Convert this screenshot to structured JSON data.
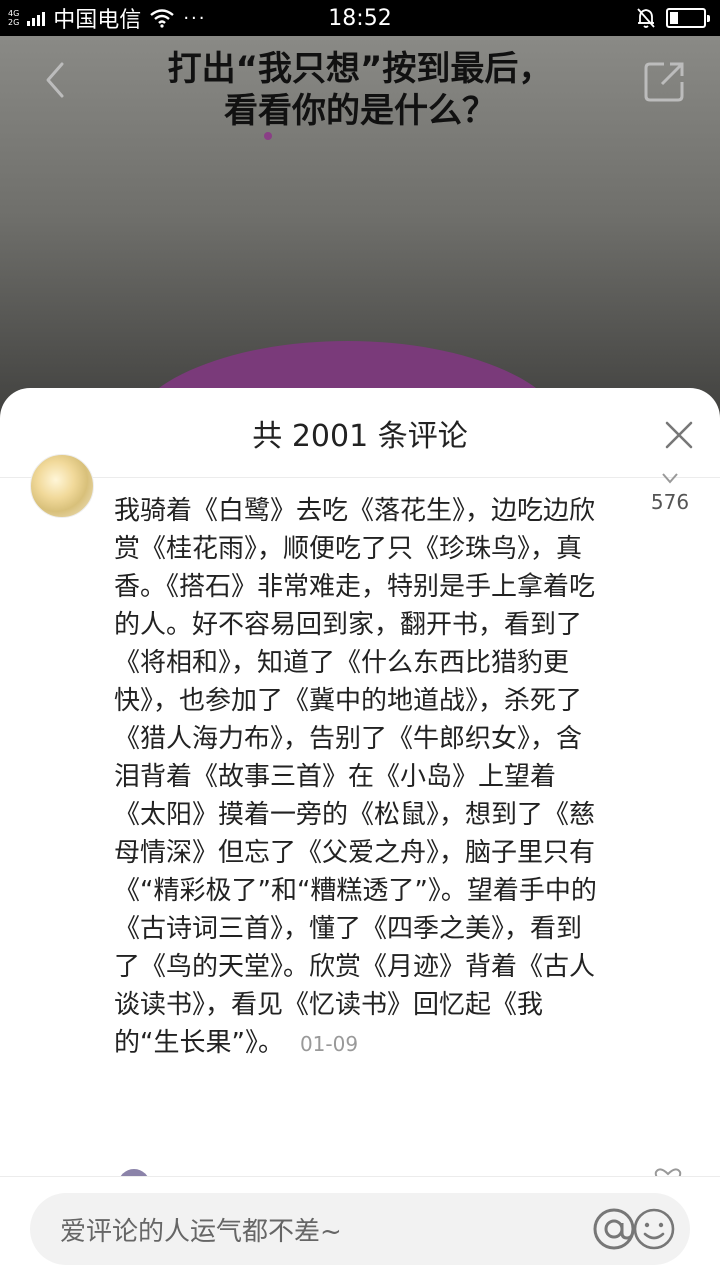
{
  "status_bar": {
    "network_top": "4G",
    "network_bottom": "2G",
    "carrier": "中国电信",
    "more": "···",
    "time": "18:52",
    "battery_level": 0.25
  },
  "video": {
    "title_line1": "打出“我只想”按到最后，",
    "title_line2": "看看你的是什么？",
    "back_icon": "back-arrow-icon",
    "share_icon": "share-icon",
    "accent_color": "#7a3a7a"
  },
  "comments_panel": {
    "title": "共 2001 条评论",
    "close_icon": "close-icon",
    "comment": {
      "like_count": "576",
      "text": "我骑着《白鹭》去吃《落花生》，边吃边欣赏《桂花雨》，顺便吃了只《珍珠鸟》，真香。《搭石》非常难走，特别是手上拿着吃的人。好不容易回到家，翻开书，看到了《将相和》，知道了《什么东西比猎豹更快》，也参加了《冀中的地道战》，杀死了《猎人海力布》，告别了《牛郎织女》，含泪背着《故事三首》在《小岛》上望着《太阳》摸着一旁的《松鼠》，想到了《慈母情深》但忘了《父爱之舟》，脑子里只有《“精彩极了”和“糟糕透了”》。望着手中的《古诗词三首》，懂了《四季之美》，看到了《鸟的天堂》。欣赏《月迹》背着《古人谈读书》，看见《忆读书》回忆起《我的“生长果”》。",
      "date": "01-09"
    }
  },
  "input": {
    "placeholder": "爱评论的人运气都不差~",
    "mention_icon": "at-icon",
    "emoji_icon": "emoji-icon"
  }
}
